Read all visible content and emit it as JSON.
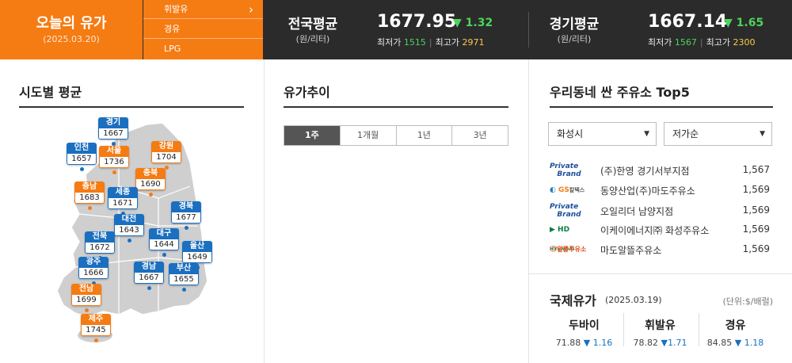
{
  "header": {
    "today_title": "오늘의 유가",
    "today_date": "(2025.03.20)",
    "fuel_menu": [
      "휘발유",
      "경유",
      "LPG"
    ],
    "chevron": "chevron-right-icon",
    "national": {
      "name": "전국평균",
      "unit": "(원/리터)",
      "price": "1677.95",
      "change": "▼ 1.32",
      "min_label": "최저가",
      "min": "1515",
      "max_label": "최고가",
      "max": "2971"
    },
    "regional": {
      "name": "경기평균",
      "unit": "(원/리터)",
      "price": "1667.14",
      "change": "▼ 1.65",
      "min_label": "최저가",
      "min": "1567",
      "max_label": "최고가",
      "max": "2300"
    }
  },
  "regions": {
    "title": "시도별 평균",
    "items": [
      {
        "name": "경기",
        "value": "1667",
        "color": "blue"
      },
      {
        "name": "인천",
        "value": "1657",
        "color": "blue"
      },
      {
        "name": "서울",
        "value": "1736",
        "color": "orange"
      },
      {
        "name": "강원",
        "value": "1704",
        "color": "orange"
      },
      {
        "name": "충북",
        "value": "1690",
        "color": "orange"
      },
      {
        "name": "충남",
        "value": "1683",
        "color": "orange"
      },
      {
        "name": "세종",
        "value": "1671",
        "color": "blue"
      },
      {
        "name": "경북",
        "value": "1677",
        "color": "blue"
      },
      {
        "name": "대전",
        "value": "1643",
        "color": "blue"
      },
      {
        "name": "전북",
        "value": "1672",
        "color": "blue"
      },
      {
        "name": "대구",
        "value": "1644",
        "color": "blue"
      },
      {
        "name": "울산",
        "value": "1649",
        "color": "blue"
      },
      {
        "name": "광주",
        "value": "1666",
        "color": "blue"
      },
      {
        "name": "경남",
        "value": "1667",
        "color": "blue"
      },
      {
        "name": "부산",
        "value": "1655",
        "color": "blue"
      },
      {
        "name": "전남",
        "value": "1699",
        "color": "orange"
      },
      {
        "name": "제주",
        "value": "1745",
        "color": "orange"
      }
    ]
  },
  "trend": {
    "title": "유가추이",
    "tabs": [
      "1주",
      "1개월",
      "1년",
      "3년"
    ],
    "active_tab": 0
  },
  "top5": {
    "title": "우리동네 싼 주유소 Top5",
    "region_select": "화성시",
    "sort_select": "저가순",
    "stations": [
      {
        "logo": "Private Brand",
        "name": "(주)한영 경기서부지점",
        "price": "1,567"
      },
      {
        "logo": "GS칼텍스",
        "name": "동양산업(주)마도주유소",
        "price": "1,569"
      },
      {
        "logo": "Private Brand",
        "name": "오일리더 남양지점",
        "price": "1,569"
      },
      {
        "logo": "HD",
        "name": "이케이에너지㈜ 화성주유소",
        "price": "1,569"
      },
      {
        "logo": "알뜰주유소",
        "name": "마도알뜰주유소",
        "price": "1,569"
      }
    ]
  },
  "intl": {
    "title": "국제유가",
    "date": "(2025.03.19)",
    "unit": "(단위:$/배럴)",
    "items": [
      {
        "name": "두바이",
        "value": "71.88",
        "change": "▼ 1.16"
      },
      {
        "name": "휘발유",
        "value": "78.82",
        "change": "▼1.71"
      },
      {
        "name": "경유",
        "value": "84.85",
        "change": "▼ 1.18"
      }
    ]
  },
  "colors": {
    "orange": "#f57b13",
    "dark": "#2b2b2b",
    "blue": "#1a6fc0",
    "green": "#4cd45a",
    "yellow": "#ffc94a"
  }
}
